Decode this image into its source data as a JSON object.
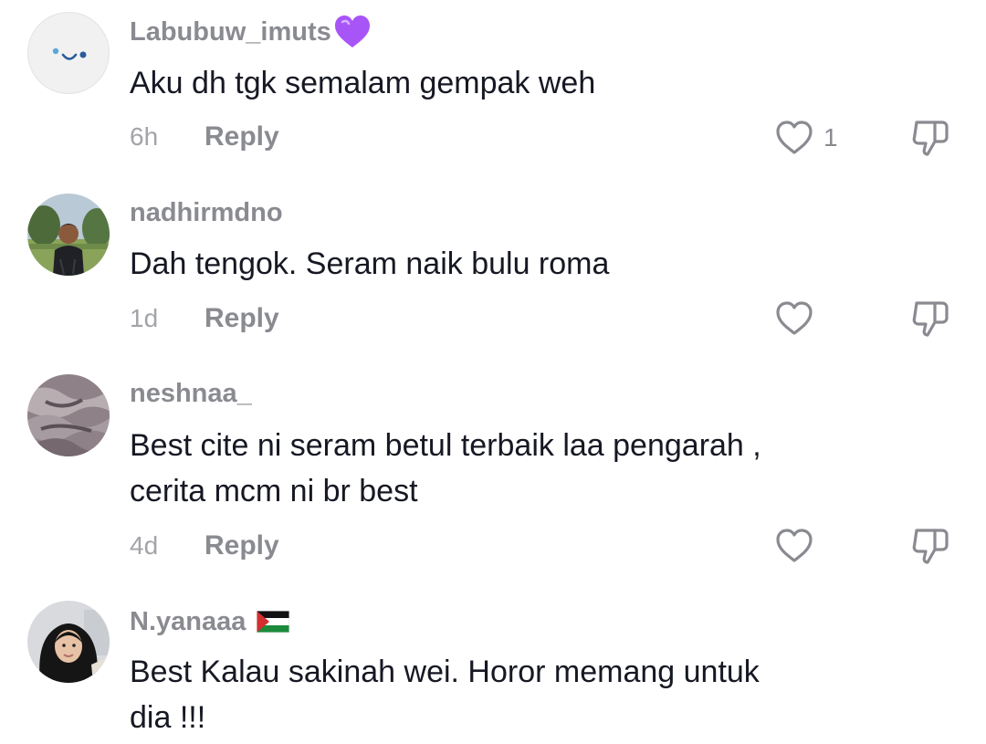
{
  "comments": [
    {
      "username": "Labubuw_imuts",
      "username_suffix": "purple-heart-emoji",
      "text": "Aku dh tgk semalam gempak weh",
      "time": "6h",
      "reply_label": "Reply",
      "like_count": "1"
    },
    {
      "username": "nadhirmdno",
      "text": "Dah tengok. Seram naik bulu roma",
      "time": "1d",
      "reply_label": "Reply",
      "like_count": ""
    },
    {
      "username": "neshnaa_",
      "text_lines": [
        "Best cite ni seram betul terbaik laa pengarah ,",
        "cerita mcm ni br best"
      ],
      "time": "4d",
      "reply_label": "Reply",
      "like_count": ""
    },
    {
      "username": "N.yanaaa",
      "username_suffix": "palestine-flag-emoji",
      "text_lines": [
        "Best Kalau sakinah wei. Horor memang untuk",
        "dia !!!"
      ]
    }
  ],
  "colors": {
    "username": "#8a8b91",
    "text": "#161823",
    "meta": "#a3a4a9",
    "icon": "#8a8b91"
  }
}
